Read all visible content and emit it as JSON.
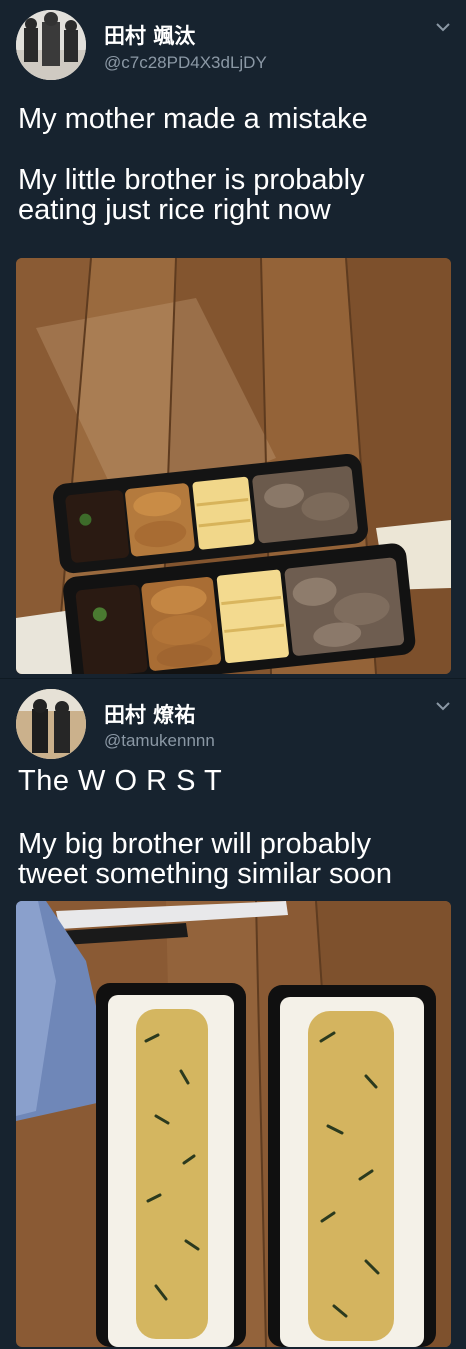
{
  "tweets": [
    {
      "display_name": "田村 颯汰",
      "handle": "@c7c28PD4X3dLjDY",
      "lines": [
        "My mother made a mistake",
        "My little brother is probably\neating just rice right now"
      ],
      "chevron_icon": "chevron-down-icon",
      "media": "bento boxes with side dishes"
    },
    {
      "display_name": "田村 燎祐",
      "handle": "@tamukennnn",
      "lines": [
        "The W O R S T",
        "My big brother will probably\ntweet something similar soon"
      ],
      "chevron_icon": "chevron-down-icon",
      "media": "bento boxes with rice only"
    }
  ],
  "colors": {
    "background": "#17232f",
    "text": "#ffffff",
    "handle": "#8b98a5"
  }
}
